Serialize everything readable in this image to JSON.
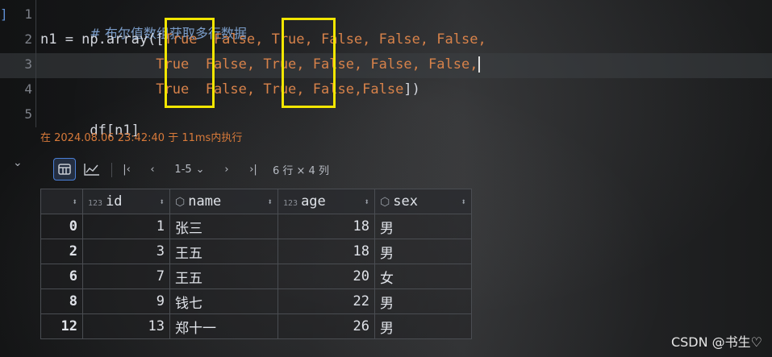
{
  "editor": {
    "gutter_mark": "]",
    "line_numbers": [
      "1",
      "2",
      "3",
      "4",
      "5"
    ],
    "lines": {
      "l1_comment": "# 布尔值数组获取多行数据",
      "l2_plain": "n1 = np.array([",
      "l2_rest": "True  False, True, False, False, False,",
      "l3_indent": "              ",
      "l3_rest": "True  False, True, False, False, False,",
      "l4_indent": "              ",
      "l4_rest": "True  False, True, False,False",
      "l4_close": "])",
      "l5_plain": "df[n1]"
    },
    "exec_info": "在 2024.08.06 23:42:40 于 11ms内执行"
  },
  "output": {
    "collapse_icon": "chevron-down-icon",
    "toolbar": {
      "table_view_icon": "table-icon",
      "chart_view_icon": "line-chart-icon",
      "first_page": "|‹",
      "prev_page": "‹",
      "range": "1-5",
      "range_dropdown": "⌄",
      "next_page": "›",
      "last_page": "›|",
      "shape": "6 行 × 4 列"
    },
    "table": {
      "columns": [
        {
          "name": "id",
          "type": "123"
        },
        {
          "name": "name",
          "type": "object"
        },
        {
          "name": "age",
          "type": "123"
        },
        {
          "name": "sex",
          "type": "object"
        }
      ],
      "rows": [
        {
          "index": "0",
          "id": "1",
          "name": "张三",
          "age": "18",
          "sex": "男"
        },
        {
          "index": "2",
          "id": "3",
          "name": "王五",
          "age": "18",
          "sex": "男"
        },
        {
          "index": "6",
          "id": "7",
          "name": "王五",
          "age": "20",
          "sex": "女"
        },
        {
          "index": "8",
          "id": "9",
          "name": "钱七",
          "age": "22",
          "sex": "男"
        },
        {
          "index": "12",
          "id": "13",
          "name": "郑十一",
          "age": "26",
          "sex": "男"
        }
      ]
    }
  },
  "watermark": "CSDN @书生♡",
  "colors": {
    "highlight_box": "#f2e600",
    "keyword_orange": "#d7824a",
    "exec_info": "#d87a3a",
    "comment": "#7a9cc8"
  }
}
